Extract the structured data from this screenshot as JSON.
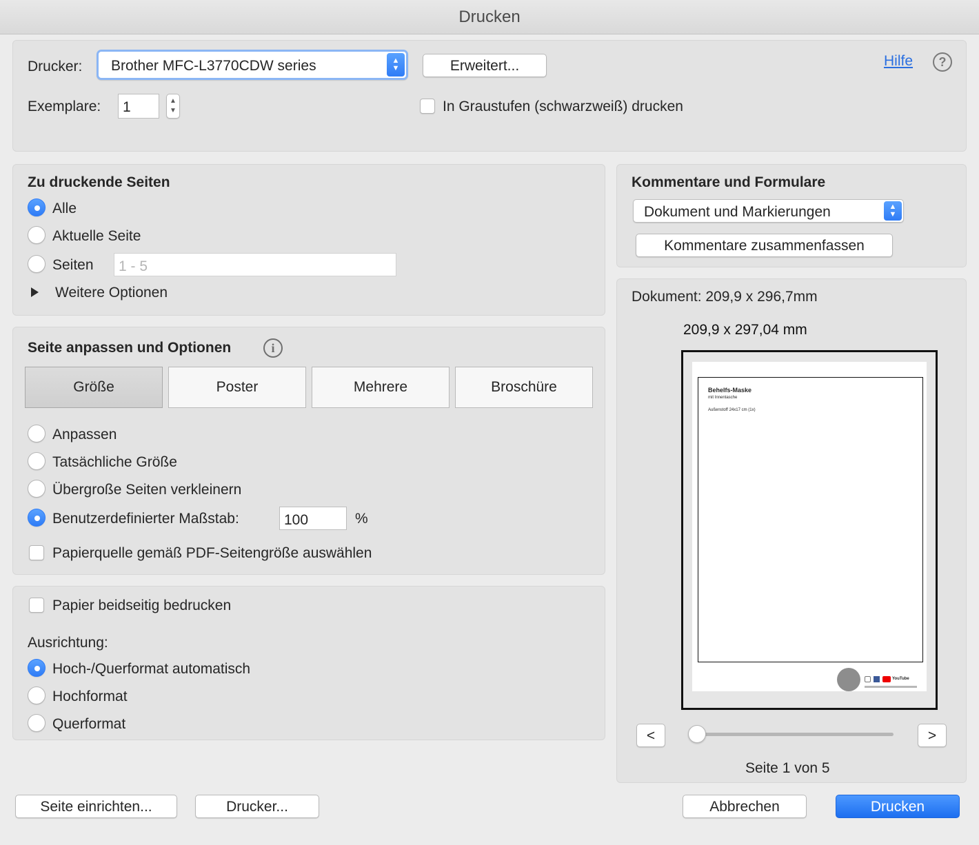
{
  "window": {
    "title": "Drucken"
  },
  "top": {
    "printer_label": "Drucker:",
    "printer_value": "Brother MFC-L3770CDW series",
    "advanced_button": "Erweitert...",
    "help_link": "Hilfe",
    "help_icon": "?",
    "copies_label": "Exemplare:",
    "copies_value": "1",
    "grayscale_label": "In Graustufen (schwarzweiß) drucken"
  },
  "pages": {
    "heading": "Zu druckende Seiten",
    "all": "Alle",
    "current": "Aktuelle Seite",
    "range": "Seiten",
    "range_placeholder": "1 - 5",
    "more_options": "Weitere Optionen",
    "selected": "all"
  },
  "fit": {
    "heading": "Seite anpassen und Optionen",
    "info_icon": "i",
    "tabs": [
      "Größe",
      "Poster",
      "Mehrere",
      "Broschüre"
    ],
    "active_tab": "Größe",
    "fit": "Anpassen",
    "actual": "Tatsächliche Größe",
    "shrink": "Übergroße Seiten verkleinern",
    "custom": "Benutzerdefinierter Maßstab:",
    "custom_value": "100",
    "percent": "%",
    "paper_source": "Papierquelle gemäß PDF-Seitengröße auswählen"
  },
  "duplex": {
    "both_sides": "Papier beidseitig bedrucken",
    "orientation_label": "Ausrichtung:",
    "auto": "Hoch-/Querformat automatisch",
    "portrait": "Hochformat",
    "landscape": "Querformat"
  },
  "comments": {
    "heading": "Kommentare und Formulare",
    "select_value": "Dokument und Markierungen",
    "summarize_button": "Kommentare zusammenfassen"
  },
  "preview": {
    "document_size": "Dokument: 209,9 x 296,7mm",
    "paper_size": "209,9 x 297,04 mm",
    "doc_title": "Behelfs-Maske",
    "doc_subtitle": "mit Innentasche",
    "doc_line": "Außenstoff 24x17 cm (1x)",
    "doc_footer_youtube": "YouTube",
    "prev": "<",
    "next": ">",
    "page_status": "Seite 1 von 5",
    "slider_value": 0
  },
  "footer": {
    "page_setup": "Seite einrichten...",
    "printer": "Drucker...",
    "cancel": "Abbrechen",
    "print": "Drucken"
  },
  "colors": {
    "accent": "#2f7cf6",
    "panel": "#e3e3e3",
    "link": "#2a6fe0"
  }
}
